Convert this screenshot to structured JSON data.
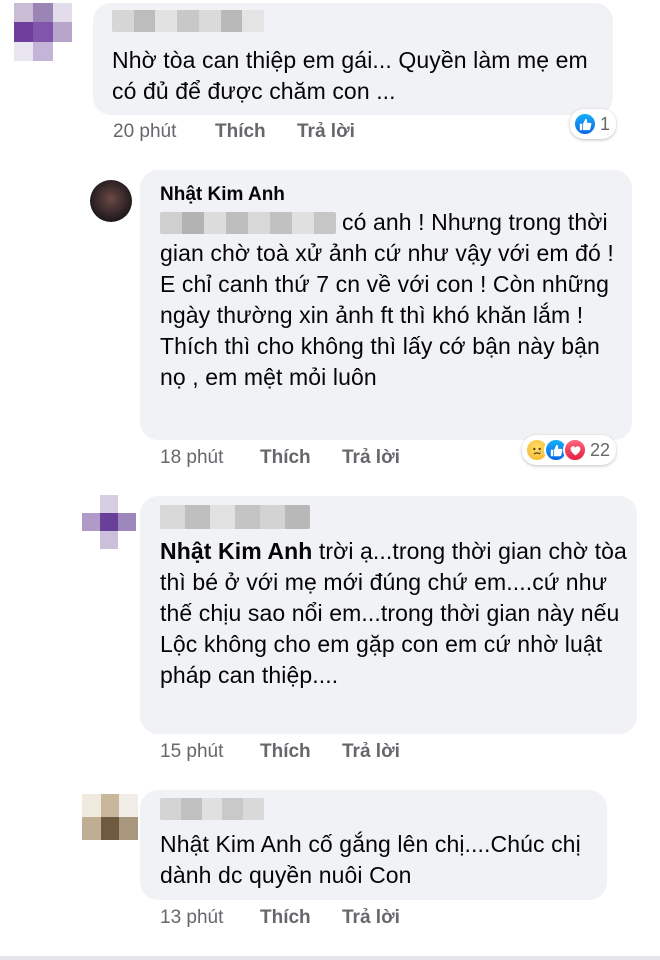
{
  "comments": [
    {
      "text": "Nhờ tòa can thiệp em gái... Quyền làm mẹ em có đủ để được chăm con ...",
      "time": "20 phút",
      "like_label": "Thích",
      "reply_label": "Trả lời",
      "reaction_count": "1",
      "reactions": [
        "like-icon"
      ]
    },
    {
      "author": "Nhật Kim Anh",
      "text": "có anh ! Nhưng trong thời gian chờ toà xử ảnh cứ như vậy với em đó ! E chỉ canh thứ 7 cn về với con ! Còn những ngày thường xin ảnh ft thì khó khăn lắm ! Thích thì cho không thì lấy cớ bận này bận nọ , em mệt mỏi luôn",
      "time": "18 phút",
      "like_label": "Thích",
      "reply_label": "Trả lời",
      "reaction_count": "22",
      "reactions": [
        "sad-icon",
        "like-icon",
        "love-icon"
      ]
    },
    {
      "mention": "Nhật Kim Anh",
      "text": " trời ạ...trong thời gian chờ tòa thì bé ở với mẹ mới đúng chứ em....cứ như thế chịu sao nổi em...trong thời gian này nếu Lộc không cho em gặp con em cứ nhờ luật pháp can thiệp....",
      "time": "15 phút",
      "like_label": "Thích",
      "reply_label": "Trả lời"
    },
    {
      "mention": "Nhật Kim Anh",
      "text": " cố gắng lên chị....Chúc chị dành dc quyền nuôi Con",
      "time": "13 phút",
      "like_label": "Thích",
      "reply_label": "Trả lời"
    }
  ],
  "colors": {
    "bubble": "#f0f2f5",
    "meta": "#65676b",
    "like": "#0a66e6",
    "love": "#e61e41"
  }
}
